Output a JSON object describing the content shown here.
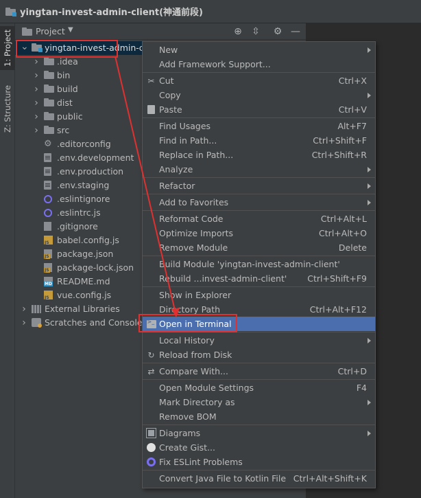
{
  "window": {
    "title": "yingtan-invest-admin-client(神通前段)"
  },
  "tool_strip": {
    "project_tab": "1: Project",
    "structure_tab": "Z: Structure"
  },
  "project_panel": {
    "view_label": "Project",
    "tree": [
      {
        "label": "yingtan-invest-admin-client",
        "kind": "module",
        "expanded": true,
        "selected": true
      },
      {
        "label": ".idea",
        "kind": "folder"
      },
      {
        "label": "bin",
        "kind": "folder"
      },
      {
        "label": "build",
        "kind": "folder"
      },
      {
        "label": "dist",
        "kind": "folder"
      },
      {
        "label": "public",
        "kind": "folder"
      },
      {
        "label": "src",
        "kind": "folder"
      },
      {
        "label": ".editorconfig",
        "kind": "config"
      },
      {
        "label": ".env.development",
        "kind": "text"
      },
      {
        "label": ".env.production",
        "kind": "text"
      },
      {
        "label": ".env.staging",
        "kind": "text"
      },
      {
        "label": ".eslintignore",
        "kind": "eslint"
      },
      {
        "label": ".eslintrc.js",
        "kind": "eslint"
      },
      {
        "label": ".gitignore",
        "kind": "git"
      },
      {
        "label": "babel.config.js",
        "kind": "js"
      },
      {
        "label": "package.json",
        "kind": "json"
      },
      {
        "label": "package-lock.json",
        "kind": "json"
      },
      {
        "label": "README.md",
        "kind": "md"
      },
      {
        "label": "vue.config.js",
        "kind": "js"
      },
      {
        "label": "External Libraries",
        "kind": "library"
      },
      {
        "label": "Scratches and Consoles",
        "kind": "scratches"
      }
    ]
  },
  "context_menu": {
    "items": [
      {
        "label": "New",
        "shortcut": "",
        "submenu": true
      },
      {
        "label": "Add Framework Support...",
        "shortcut": ""
      },
      {
        "label": "Cut",
        "shortcut": "Ctrl+X",
        "icon": "cut-icon"
      },
      {
        "label": "Copy",
        "shortcut": "",
        "submenu": true
      },
      {
        "label": "Paste",
        "shortcut": "Ctrl+V",
        "icon": "paste-icon"
      },
      {
        "label": "Find Usages",
        "shortcut": "Alt+F7"
      },
      {
        "label": "Find in Path...",
        "shortcut": "Ctrl+Shift+F"
      },
      {
        "label": "Replace in Path...",
        "shortcut": "Ctrl+Shift+R"
      },
      {
        "label": "Analyze",
        "shortcut": "",
        "submenu": true
      },
      {
        "label": "Refactor",
        "shortcut": "",
        "submenu": true
      },
      {
        "label": "Add to Favorites",
        "shortcut": "",
        "submenu": true
      },
      {
        "label": "Reformat Code",
        "shortcut": "Ctrl+Alt+L"
      },
      {
        "label": "Optimize Imports",
        "shortcut": "Ctrl+Alt+O"
      },
      {
        "label": "Remove Module",
        "shortcut": "Delete"
      },
      {
        "label": "Build Module 'yingtan-invest-admin-client'",
        "shortcut": ""
      },
      {
        "label": "Rebuild ...invest-admin-client'",
        "shortcut": "Ctrl+Shift+F9"
      },
      {
        "label": "Show in Explorer",
        "shortcut": ""
      },
      {
        "label": "Directory Path",
        "shortcut": "Ctrl+Alt+F12"
      },
      {
        "label": "Open in Terminal",
        "shortcut": "",
        "icon": "terminal-icon",
        "highlighted": true
      },
      {
        "label": "Local History",
        "shortcut": "",
        "submenu": true
      },
      {
        "label": "Reload from Disk",
        "shortcut": "",
        "icon": "reload-icon"
      },
      {
        "label": "Compare With...",
        "shortcut": "Ctrl+D",
        "icon": "compare-icon"
      },
      {
        "label": "Open Module Settings",
        "shortcut": "F4"
      },
      {
        "label": "Mark Directory as",
        "shortcut": "",
        "submenu": true
      },
      {
        "label": "Remove BOM",
        "shortcut": ""
      },
      {
        "label": "Diagrams",
        "shortcut": "",
        "submenu": true,
        "icon": "diagrams-icon"
      },
      {
        "label": "Create Gist...",
        "shortcut": "",
        "icon": "github-icon"
      },
      {
        "label": "Fix ESLint Problems",
        "shortcut": "",
        "icon": "eslint-icon"
      },
      {
        "label": "Convert Java File to Kotlin File",
        "shortcut": "Ctrl+Alt+Shift+K"
      }
    ]
  },
  "colors": {
    "highlight": "#4b6eaf",
    "annotation": "#e03030",
    "selection": "#0d293e"
  }
}
